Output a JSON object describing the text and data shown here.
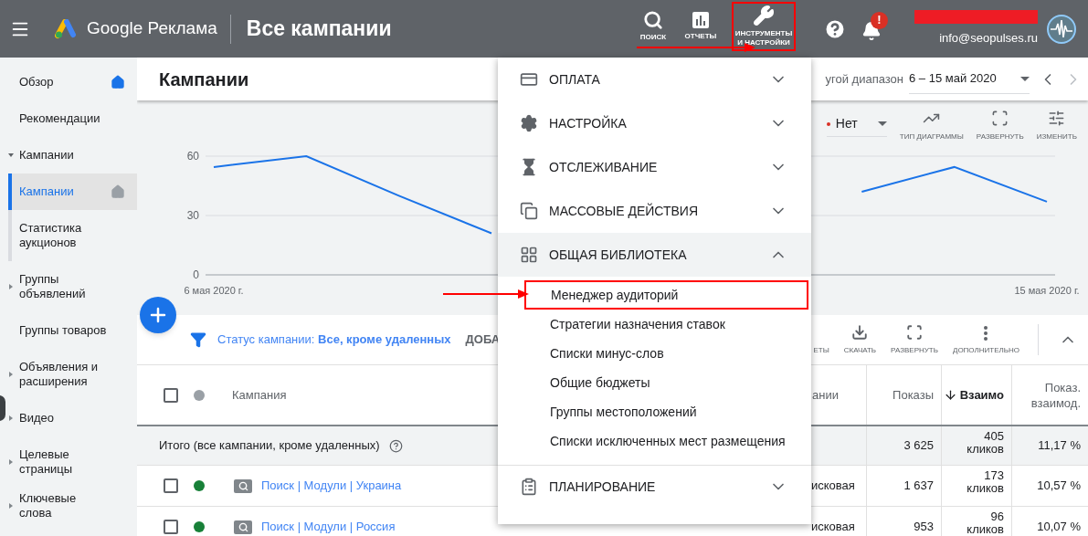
{
  "header": {
    "app_name": "Google Реклама",
    "page_title": "Все кампании",
    "tools": [
      {
        "label": "ПОИСК",
        "annotated": false
      },
      {
        "label": "ОТЧЕТЫ",
        "annotated": false
      },
      {
        "label": "ИНСТРУМЕНТЫ И НАСТРОЙКИ",
        "annotated": true
      }
    ],
    "notification_badge": "!",
    "account_email": "info@seopulses.ru"
  },
  "sidebar": {
    "items": [
      {
        "label": "Обзор",
        "kind": "page",
        "selected": false,
        "home_icon": true
      },
      {
        "label": "Рекомендации",
        "kind": "page",
        "selected": false,
        "home_icon": false
      },
      {
        "label": "Кампании",
        "kind": "group",
        "expanded": true,
        "selected": false,
        "children": [
          {
            "label": "Кампании",
            "selected": true,
            "home_icon": true
          },
          {
            "label": "Статистика аукционов",
            "selected": false,
            "home_icon": false
          }
        ]
      },
      {
        "label": "Группы объявлений",
        "kind": "group",
        "expanded": false,
        "selected": false
      },
      {
        "label": "Группы товаров",
        "kind": "page",
        "selected": false,
        "home_icon": false
      },
      {
        "label": "Объявления и расширения",
        "kind": "group",
        "expanded": false,
        "selected": false
      },
      {
        "label": "Видео",
        "kind": "group",
        "expanded": false,
        "selected": false
      },
      {
        "label": "Целевые страницы",
        "kind": "group",
        "expanded": false,
        "selected": false
      },
      {
        "label": "Ключевые слова",
        "kind": "group",
        "expanded": false,
        "selected": false
      }
    ]
  },
  "page": {
    "title": "Кампании",
    "date_range": {
      "preset_label": "угой диапазон",
      "value": "6 – 15 май 2020"
    }
  },
  "chart": {
    "compare": "Нет",
    "actions": [
      "ТИП ДИАГРАММЫ",
      "РАЗВЕРНУТЬ",
      "ИЗМЕНИТЬ"
    ],
    "chart_data": {
      "type": "line",
      "categories": [
        "6 мая 2020 г.",
        null,
        null,
        null,
        null,
        null,
        null,
        null,
        null,
        "15 мая 2020 г."
      ],
      "series": [
        {
          "color": "#1a73e8",
          "values": [
            54.5,
            60,
            40,
            21,
            null,
            null,
            null,
            42,
            54.5,
            37
          ]
        }
      ],
      "ylim": [
        0,
        60
      ],
      "yticks": [
        0,
        30,
        60
      ]
    }
  },
  "filter_bar": {
    "status": "Статус кампании: **Все, кроме удаленных**",
    "add_label": "ДОБА",
    "actions": [
      "ЕТЫ",
      "СКАЧАТЬ",
      "РАЗВЕРНУТЬ",
      "ДОПОЛНИТЕЛЬНО"
    ]
  },
  "table": {
    "header_checked": false,
    "columns": [
      {
        "label": "Кампания",
        "sorted": false
      },
      {
        "label": "ании",
        "sorted": false
      },
      {
        "label": "Показы",
        "sorted": false
      },
      {
        "label": "Взаимо",
        "sorted": true
      },
      {
        "label": "Показ. взаимод.",
        "sorted": false
      }
    ],
    "total": {
      "label": "Итого (все кампании, кроме удаленных)",
      "impressions": "3 625",
      "interactions": "405 кликов",
      "rate": "11,17 %"
    },
    "rows": [
      {
        "checked": false,
        "color": "#188038",
        "name": "Поиск | Модули | Украина",
        "type": "исковая",
        "impressions": "1 637",
        "interactions": "173 кликов",
        "rate": "10,57 %"
      },
      {
        "checked": false,
        "color": "#188038",
        "name": "Поиск | Модули | Россия",
        "type": "исковая",
        "impressions": "953",
        "interactions": "96 кликов",
        "rate": "10,07 %"
      }
    ]
  },
  "tools_menu": {
    "sections": [
      {
        "label": "ОПЛАТА",
        "expanded": false
      },
      {
        "label": "НАСТРОЙКА",
        "expanded": false
      },
      {
        "label": "ОТСЛЕЖИВАНИЕ",
        "expanded": false
      },
      {
        "label": "МАССОВЫЕ ДЕЙСТВИЯ",
        "expanded": false
      },
      {
        "label": "ОБЩАЯ БИБЛИОТЕКА",
        "expanded": true,
        "items": [
          {
            "label": "Менеджер аудиторий",
            "annotated": true
          },
          {
            "label": "Стратегии назначения ставок",
            "annotated": false
          },
          {
            "label": "Списки минус-слов",
            "annotated": false
          },
          {
            "label": "Общие бюджеты",
            "annotated": false
          },
          {
            "label": "Группы местоположений",
            "annotated": false
          },
          {
            "label": "Списки исключенных мест размещения",
            "annotated": false
          }
        ]
      },
      {
        "label": "ПЛАНИРОВАНИЕ",
        "expanded": false
      }
    ]
  }
}
